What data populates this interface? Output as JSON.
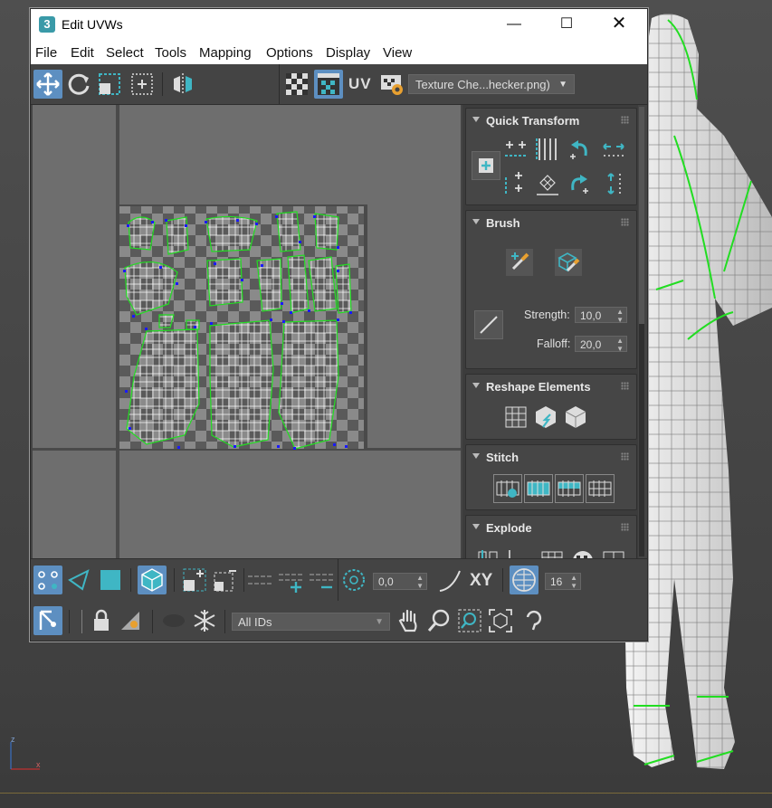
{
  "window": {
    "title": "Edit UVWs",
    "app_icon_text": "3"
  },
  "menubar": [
    "File",
    "Edit",
    "Select",
    "Tools",
    "Mapping",
    "Options",
    "Display",
    "View"
  ],
  "toolbar_top": {
    "uv_label": "UV",
    "texture_dropdown": "Texture Che...hecker.png)"
  },
  "panels": {
    "quick_transform": {
      "title": "Quick Transform"
    },
    "brush": {
      "title": "Brush",
      "strength_label": "Strength:",
      "strength_value": "10,0",
      "falloff_label": "Falloff:",
      "falloff_value": "20,0"
    },
    "reshape": {
      "title": "Reshape Elements"
    },
    "stitch": {
      "title": "Stitch"
    },
    "explode": {
      "title": "Explode"
    }
  },
  "toolbar_bottom": {
    "rotate_value": "0,0",
    "xy_label": "XY",
    "spacing_value": "16",
    "ids_dropdown": "All IDs"
  },
  "colors": {
    "accent_blue": "#5d8fc1",
    "accent_teal": "#3fb6c4",
    "uv_green": "#22dd22",
    "vertex_blue": "#1a1aff"
  }
}
